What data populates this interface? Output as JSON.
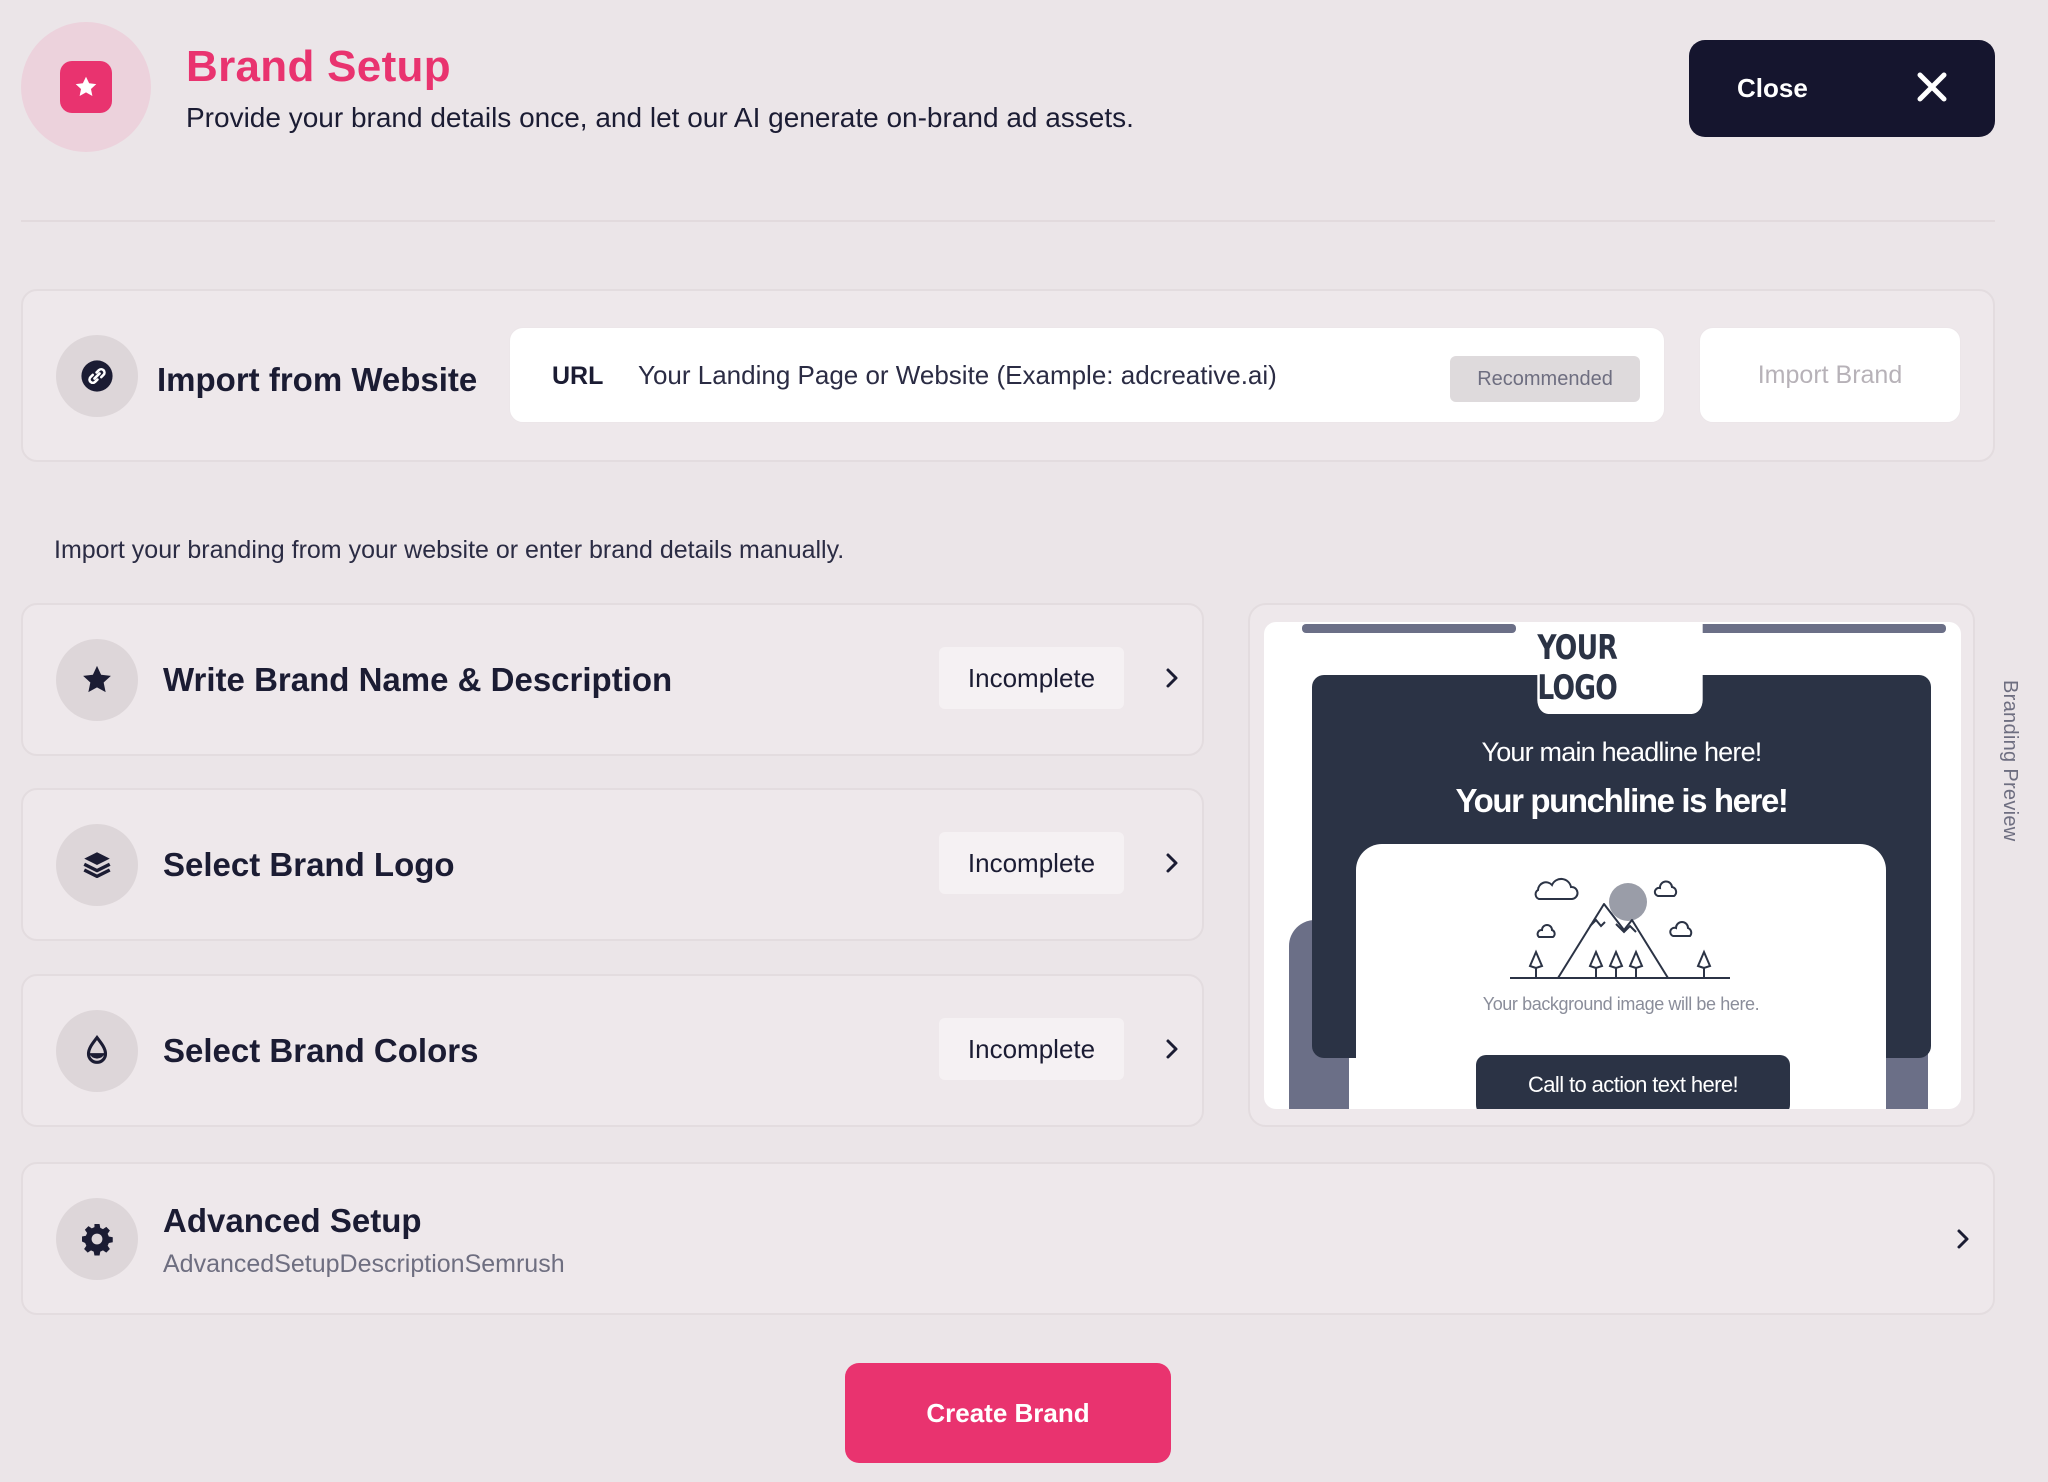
{
  "header": {
    "title": "Brand Setup",
    "subtitle": "Provide your brand details once, and let our AI generate on-brand ad assets.",
    "icon": "star-badge-icon",
    "close_label": "Close"
  },
  "import": {
    "title": "Import from Website",
    "icon": "link-icon",
    "url_label": "URL",
    "url_placeholder": "Your Landing Page or Website (Example: adcreative.ai)",
    "url_value": "",
    "badge": "Recommended",
    "button_label": "Import Brand"
  },
  "helper_text": "Import your branding from your website or enter brand details manually.",
  "steps": [
    {
      "title": "Write Brand Name & Description",
      "status": "Incomplete",
      "icon": "star-icon"
    },
    {
      "title": "Select Brand Logo",
      "status": "Incomplete",
      "icon": "layers-icon"
    },
    {
      "title": "Select Brand Colors",
      "status": "Incomplete",
      "icon": "droplet-icon"
    }
  ],
  "preview": {
    "label": "Branding Preview",
    "logo": "YOUR LOGO",
    "headline": "Your main headline here!",
    "punchline": "Your punchline is here!",
    "image_caption": "Your background image will be here.",
    "cta": "Call to action text here!"
  },
  "advanced": {
    "title": "Advanced Setup",
    "description": "AdvancedSetupDescriptionSemrush",
    "icon": "gear-icon"
  },
  "create_label": "Create Brand",
  "colors": {
    "accent": "#e9336f",
    "dark": "#15152e",
    "background": "#ebe5e8",
    "preview_dark": "#2b3345"
  }
}
